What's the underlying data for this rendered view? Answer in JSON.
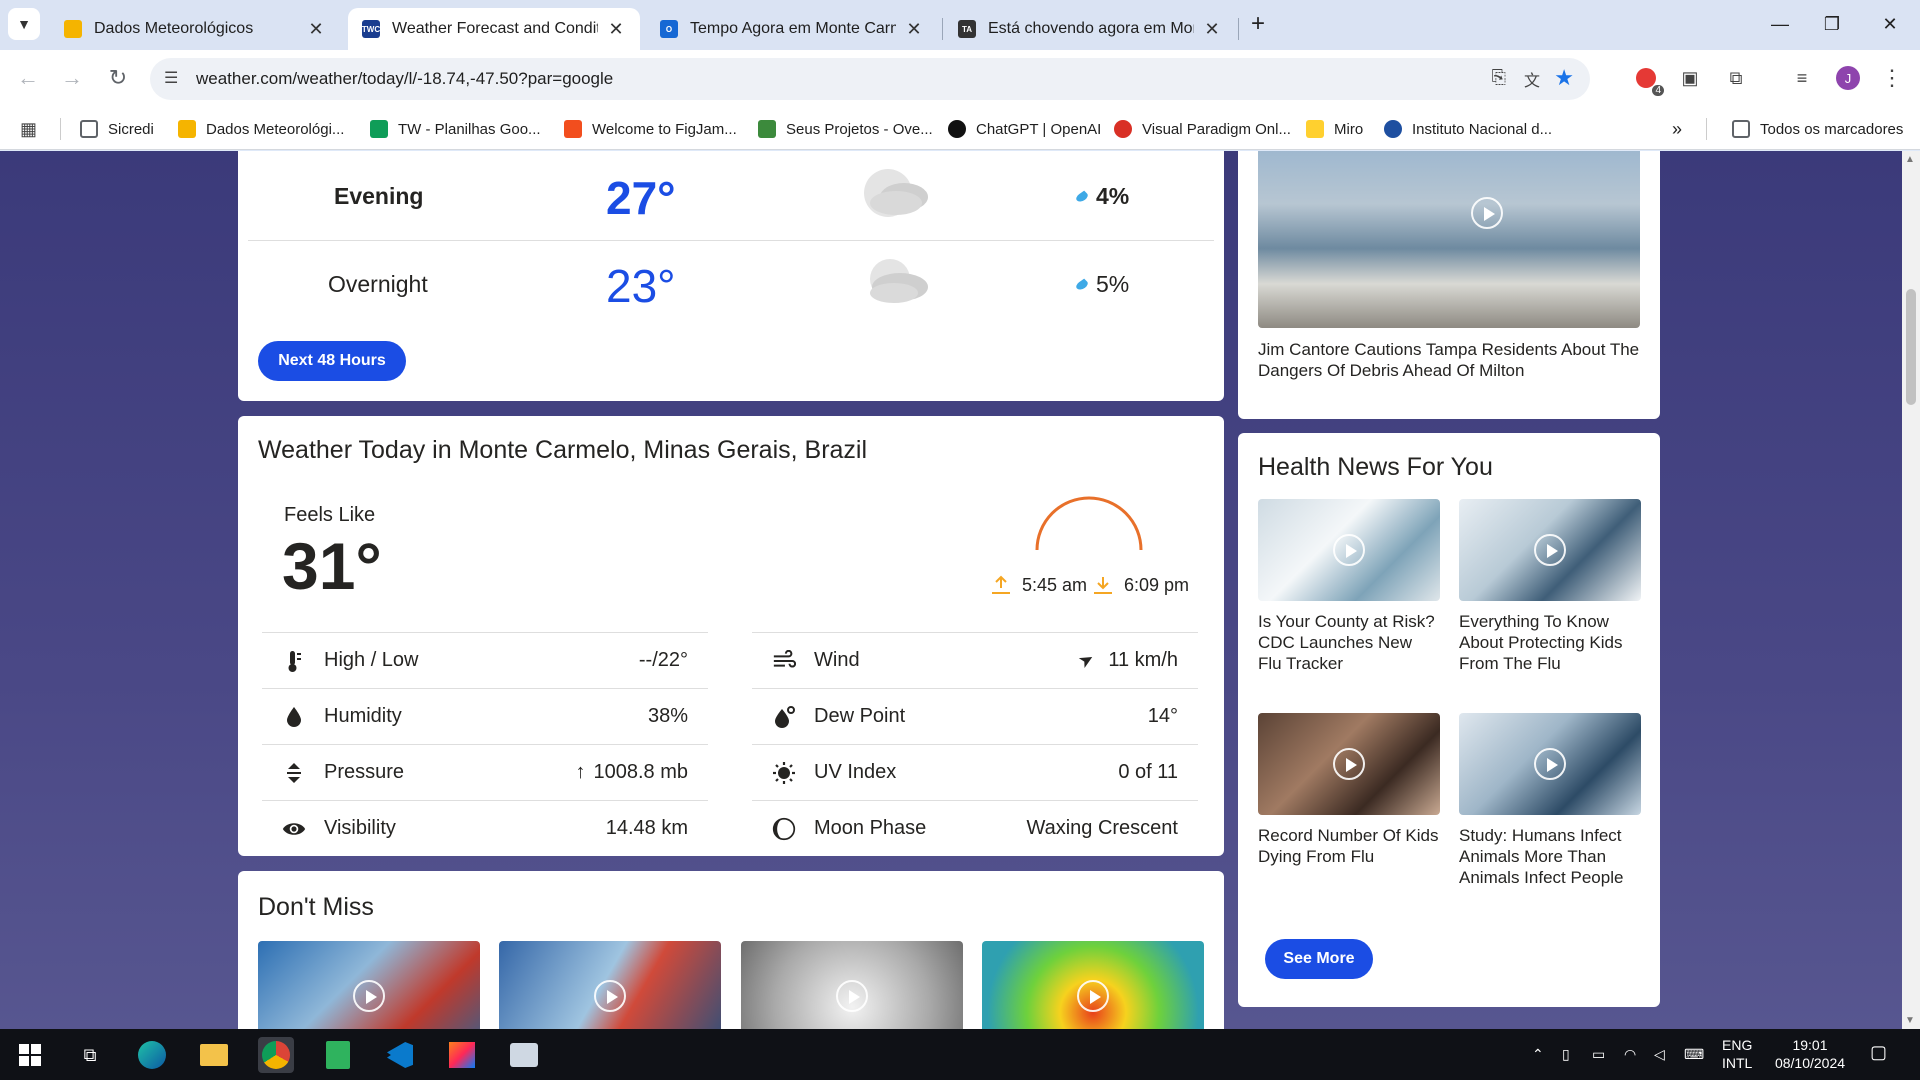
{
  "browser": {
    "tabs": [
      {
        "title": "Dados Meteorológicos",
        "color": "#f5b400"
      },
      {
        "title": "Weather Forecast and Conditions",
        "color": "#1a3d8f"
      },
      {
        "title": "Tempo Agora em Monte Carmelo",
        "color": "#1668d4"
      },
      {
        "title": "Está chovendo agora em Monte Carmelo",
        "color": "#333333"
      }
    ],
    "url": "weather.com/weather/today/l/-18.74,-47.50?par=google",
    "extension_badge": "4",
    "profile_initial": "J",
    "bookmarks": [
      {
        "label": "Sicredi",
        "color": "#5f6368"
      },
      {
        "label": "Dados Meteorológi...",
        "color": "#f5b400"
      },
      {
        "label": "TW - Planilhas Goo...",
        "color": "#0f9d58"
      },
      {
        "label": "Welcome to FigJam...",
        "color": "#f24e1e"
      },
      {
        "label": "Seus Projetos - Ove...",
        "color": "#3c8a3c"
      },
      {
        "label": "ChatGPT | OpenAI",
        "color": "#111111"
      },
      {
        "label": "Visual Paradigm Onl...",
        "color": "#d93025"
      },
      {
        "label": "Miro",
        "color": "#ffd02f"
      },
      {
        "label": "Instituto Nacional d...",
        "color": "#1e4fa0"
      }
    ],
    "all_bookmarks": "Todos os marcadores"
  },
  "hourly": {
    "rows": [
      {
        "period": "Evening",
        "temp": "27°",
        "rain": "4%"
      },
      {
        "period": "Overnight",
        "temp": "23°",
        "rain": "5%"
      }
    ],
    "next_button": "Next 48 Hours"
  },
  "today": {
    "heading": "Weather Today in Monte Carmelo, Minas Gerais, Brazil",
    "feels_like_label": "Feels Like",
    "feels_like_value": "31°",
    "sunrise": "5:45 am",
    "sunset": "6:09 pm",
    "left": [
      {
        "name": "High / Low",
        "value": "--/22°"
      },
      {
        "name": "Humidity",
        "value": "38%"
      },
      {
        "name": "Pressure",
        "value": "1008.8 mb"
      },
      {
        "name": "Visibility",
        "value": "14.48 km"
      }
    ],
    "right": [
      {
        "name": "Wind",
        "value": "11 km/h"
      },
      {
        "name": "Dew Point",
        "value": "14°"
      },
      {
        "name": "UV Index",
        "value": "0 of 11"
      },
      {
        "name": "Moon Phase",
        "value": "Waxing Crescent"
      }
    ]
  },
  "dont_miss": {
    "heading": "Don't Miss"
  },
  "video": {
    "caption": "Jim Cantore Cautions Tampa Residents About The Dangers Of Debris Ahead Of Milton"
  },
  "health": {
    "heading": "Health News For You",
    "items": [
      {
        "caption": "Is Your County at Risk? CDC Launches New Flu Tracker"
      },
      {
        "caption": "Everything To Know About Protecting Kids From The Flu"
      },
      {
        "caption": "Record Number Of Kids Dying From Flu"
      },
      {
        "caption": "Study: Humans Infect Animals More Than Animals Infect People"
      }
    ],
    "see_more": "See More"
  },
  "taskbar": {
    "lang1": "ENG",
    "lang2": "INTL",
    "time": "19:01",
    "date": "08/10/2024"
  }
}
